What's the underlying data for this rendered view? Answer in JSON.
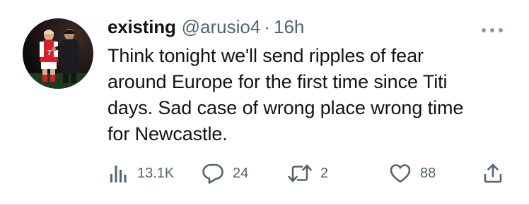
{
  "tweet": {
    "display_name": "existing",
    "handle": "@arusio4",
    "separator": "·",
    "time": "16h",
    "text": "Think tonight we'll send ripples of fear\naround Europe for the first time since Titi\ndays. Sad case of wrong place wrong time\nfor Newcastle.",
    "avatar_icon": "profile-photo-football-players"
  },
  "actions": {
    "views": {
      "icon": "analytics-icon",
      "count": "13.1K"
    },
    "reply": {
      "icon": "reply-icon",
      "count": "24"
    },
    "retweet": {
      "icon": "retweet-icon",
      "count": "2"
    },
    "like": {
      "icon": "heart-icon",
      "count": "88"
    },
    "share": {
      "icon": "share-icon"
    }
  },
  "colors": {
    "text": "#0f1419",
    "secondary": "#536471",
    "border": "#cfd9de"
  }
}
